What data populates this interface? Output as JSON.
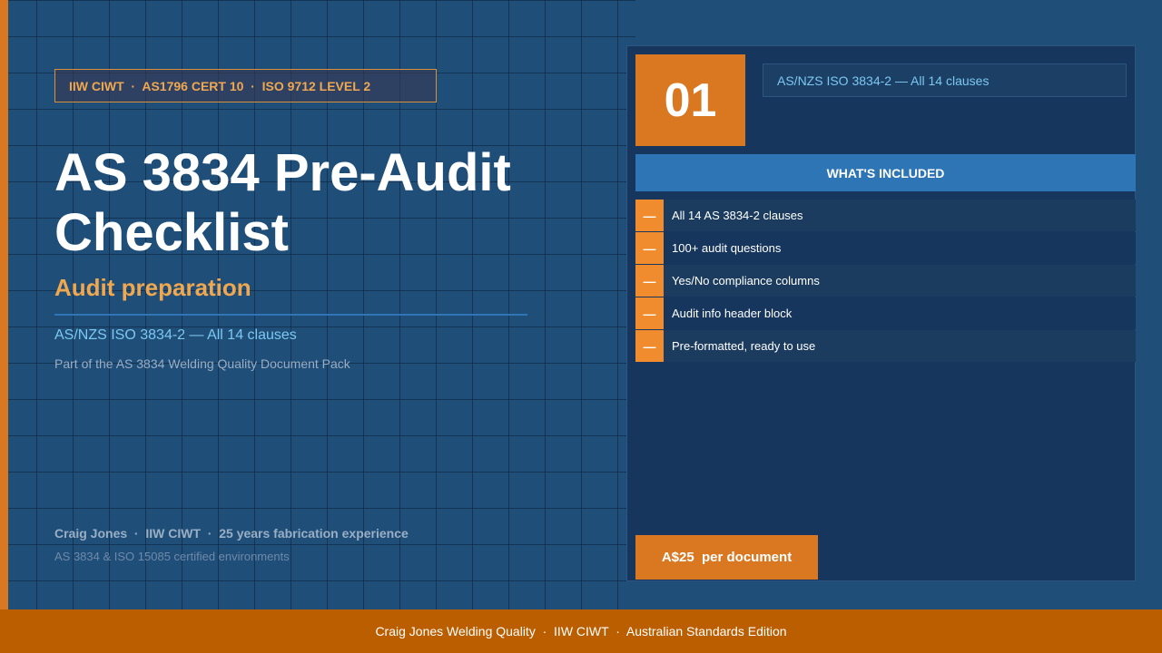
{
  "left": {
    "credentials_badge": "IIW CIWT  ·  AS1796 CERT 10  ·  ISO 9712 LEVEL 2",
    "title": "AS 3834 Pre-Audit Checklist",
    "subtitle": "Audit preparation",
    "standard": "AS/NZS ISO 3834-2 — All 14 clauses",
    "pack": "Part of the AS 3834 Welding Quality Document Pack",
    "author": "Craig Jones  ·  IIW CIWT  ·  25 years fabrication experience",
    "certified": "AS 3834 & ISO 15085 certified environments"
  },
  "panel": {
    "number": "01",
    "standard_box": "AS/NZS ISO 3834-2 — All 14 clauses",
    "included_header": "WHAT'S INCLUDED",
    "item_marker": "—",
    "items": [
      "All 14 AS 3834-2 clauses",
      "100+ audit questions",
      "Yes/No compliance columns",
      "Audit info header block",
      "Pre-formatted, ready to use"
    ],
    "price": "A$25  per document"
  },
  "footer": "Craig Jones Welding Quality  ·  IIW CIWT  ·  Australian Standards Edition",
  "colors": {
    "background": "#1f4e79",
    "accent_orange": "#d97820",
    "heading_orange": "#f0a850",
    "panel": "#17365d",
    "header_blue": "#2e75b6",
    "link_blue": "#7cc8f0",
    "footer": "#bb5e00"
  }
}
